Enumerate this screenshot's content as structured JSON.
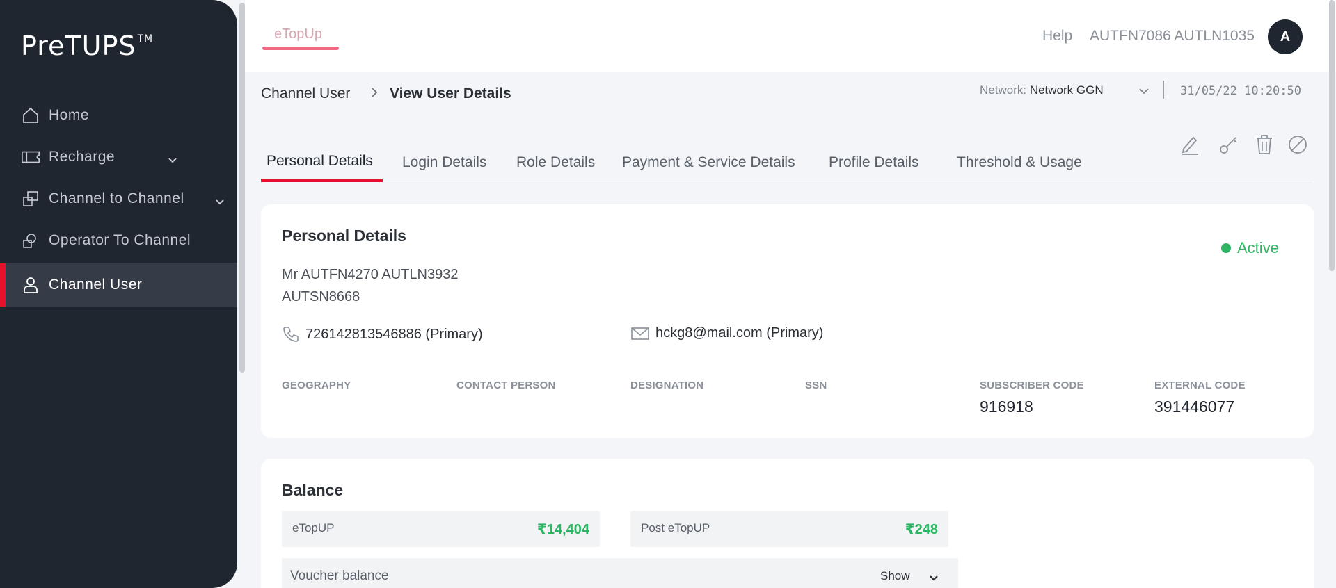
{
  "app": {
    "logo": "PreTUPS",
    "logo_tm": "TM"
  },
  "sidebar": {
    "items": [
      {
        "label": "Home",
        "icon": "home-icon"
      },
      {
        "label": "Recharge",
        "icon": "ticket-icon",
        "has_submenu": true
      },
      {
        "label": "Channel to Channel",
        "icon": "transfer-icon",
        "has_submenu": true
      },
      {
        "label": "Operator To Channel",
        "icon": "operator-transfer-icon"
      },
      {
        "label": "Channel User",
        "icon": "user-icon",
        "active": true
      }
    ]
  },
  "header": {
    "top_tab": "eTopUp",
    "help": "Help",
    "username": "AUTFN7086 AUTLN1035",
    "avatar_initial": "A"
  },
  "breadcrumb": {
    "parent": "Channel User",
    "separator": ">",
    "current": "View User Details"
  },
  "network": {
    "label": "Network:",
    "value": "Network GGN",
    "datetime": "31/05/22 10:20:50"
  },
  "tabs": [
    {
      "label": "Personal Details",
      "active": true
    },
    {
      "label": "Login Details"
    },
    {
      "label": "Role Details"
    },
    {
      "label": "Payment & Service Details"
    },
    {
      "label": "Profile Details"
    },
    {
      "label": "Threshold & Usage"
    }
  ],
  "actions": [
    "edit-icon",
    "key-icon",
    "delete-icon",
    "block-icon"
  ],
  "personal": {
    "title": "Personal Details",
    "status": "Active",
    "status_color": "#2fb463",
    "full_name": "Mr AUTFN4270 AUTLN3932",
    "short_name": "AUTSN8668",
    "phone": "726142813546886 (Primary)",
    "email": "hckg8@mail.com (Primary)",
    "fields": [
      {
        "label": "GEOGRAPHY",
        "value": ""
      },
      {
        "label": "CONTACT PERSON",
        "value": ""
      },
      {
        "label": "DESIGNATION",
        "value": ""
      },
      {
        "label": "SSN",
        "value": ""
      },
      {
        "label": "SUBSCRIBER CODE",
        "value": "916918"
      },
      {
        "label": "EXTERNAL CODE",
        "value": "391446077"
      }
    ]
  },
  "balance": {
    "title": "Balance",
    "items": [
      {
        "label": "eTopUP",
        "value": "₹14,404"
      },
      {
        "label": "Post eTopUP",
        "value": "₹248"
      }
    ],
    "voucher": {
      "label": "Voucher balance",
      "toggle": "Show"
    }
  },
  "colors": {
    "accent": "#e8112d",
    "sidebar": "#1f2630",
    "success": "#2fb463"
  }
}
